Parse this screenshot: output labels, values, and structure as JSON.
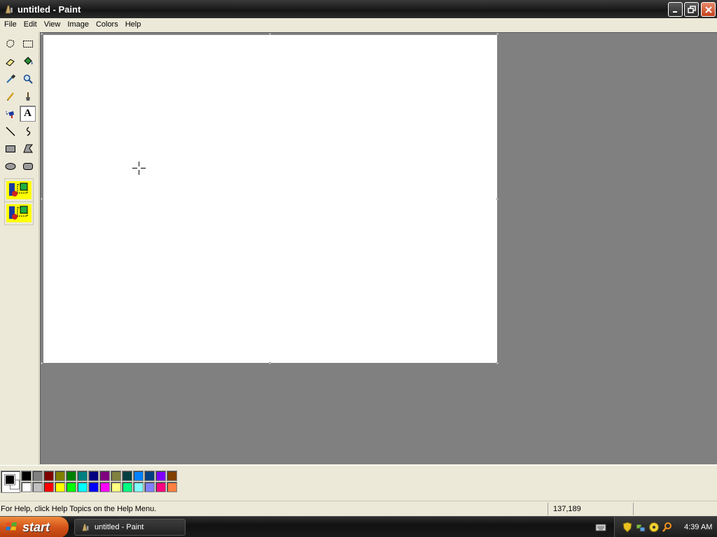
{
  "window": {
    "title": "untitled - Paint"
  },
  "menu": {
    "items": [
      "File",
      "Edit",
      "View",
      "Image",
      "Colors",
      "Help"
    ]
  },
  "toolbox": {
    "tools": [
      {
        "name": "free-form-select",
        "icon": "free-form-select-icon"
      },
      {
        "name": "select",
        "icon": "rect-select-icon"
      },
      {
        "name": "eraser",
        "icon": "eraser-icon"
      },
      {
        "name": "fill-with-color",
        "icon": "paint-bucket-icon"
      },
      {
        "name": "pick-color",
        "icon": "eyedropper-icon"
      },
      {
        "name": "magnifier",
        "icon": "magnifier-icon"
      },
      {
        "name": "pencil",
        "icon": "pencil-icon"
      },
      {
        "name": "brush",
        "icon": "brush-icon"
      },
      {
        "name": "airbrush",
        "icon": "airbrush-icon"
      },
      {
        "name": "text",
        "icon": "text-icon",
        "label": "A",
        "selected": true
      },
      {
        "name": "line",
        "icon": "line-icon"
      },
      {
        "name": "curve",
        "icon": "curve-icon"
      },
      {
        "name": "rectangle",
        "icon": "rectangle-icon"
      },
      {
        "name": "polygon",
        "icon": "polygon-icon"
      },
      {
        "name": "ellipse",
        "icon": "ellipse-icon"
      },
      {
        "name": "rounded-rectangle",
        "icon": "rounded-rectangle-icon"
      }
    ],
    "options": [
      "opaque-background-option-icon",
      "transparent-background-option-icon"
    ]
  },
  "palette": {
    "foreground": "#000000",
    "background": "#ffffff",
    "row1": [
      "#000000",
      "#808080",
      "#800000",
      "#808000",
      "#008000",
      "#008080",
      "#000080",
      "#800080",
      "#808040",
      "#004040",
      "#0080ff",
      "#004080",
      "#8000ff",
      "#804000"
    ],
    "row2": [
      "#ffffff",
      "#c0c0c0",
      "#ff0000",
      "#ffff00",
      "#00ff00",
      "#00ffff",
      "#0000ff",
      "#ff00ff",
      "#ffff80",
      "#00ff80",
      "#80ffff",
      "#8080ff",
      "#ff0080",
      "#ff8040"
    ]
  },
  "status": {
    "help_text": "For Help, click Help Topics on the Help Menu.",
    "coordinates": "137,189"
  },
  "taskbar": {
    "start_label": "start",
    "task_title": "untitled - Paint",
    "clock": "4:39 AM"
  }
}
